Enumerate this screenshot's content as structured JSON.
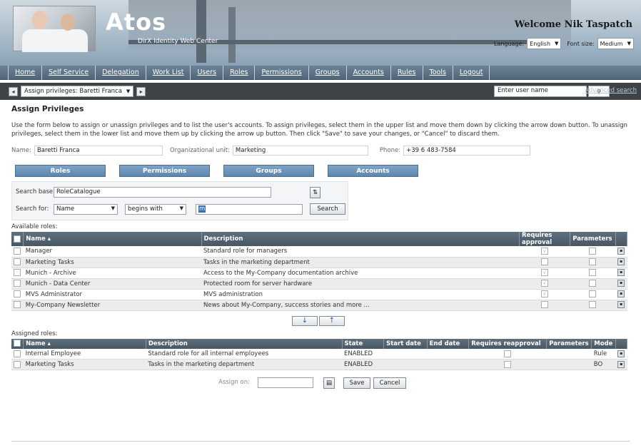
{
  "header": {
    "logo": "Atos",
    "subtitle": "DirX Identity Web Center",
    "welcome": "Welcome Nik Taspatch",
    "language_label": "Language:",
    "language_value": "English",
    "fontsize_label": "Font size:",
    "fontsize_value": "Medium"
  },
  "nav": [
    "Home",
    "Self Service",
    "Delegation",
    "Work List",
    "Users",
    "Roles",
    "Permissions",
    "Groups",
    "Accounts",
    "Rules",
    "Tools",
    "Logout"
  ],
  "toolbar": {
    "crumb": "Assign privileges: Baretti Franca",
    "user_search_placeholder": "Enter user name",
    "advanced_search": "Advanced search"
  },
  "page": {
    "title": "Assign Privileges",
    "instructions": "Use the form below to assign or unassign privileges and to list the user's accounts. To assign privileges, select them in the upper list and move them down by clicking the arrow down button. To unassign privileges, select them in the lower list and move them up by clicking the arrow up button. Then click \"Save\" to save your changes, or \"Cancel\" to discard them.",
    "name_label": "Name:",
    "name_value": "Baretti Franca",
    "ou_label": "Organizational unit:",
    "ou_value": "Marketing",
    "phone_label": "Phone:",
    "phone_value": "+39 6 483-7584"
  },
  "tabs": [
    "Roles",
    "Permissions",
    "Groups",
    "Accounts"
  ],
  "search": {
    "base_label": "Search base:",
    "base_value": "RoleCatalogue",
    "for_label": "Search for:",
    "attr_value": "Name",
    "op_value": "begins with",
    "text_value": "m",
    "button": "Search"
  },
  "available": {
    "label": "Available roles:",
    "columns": [
      "Name",
      "Description",
      "Requires approval",
      "Parameters"
    ],
    "rows": [
      {
        "name": "Manager",
        "desc": "Standard role for managers",
        "approval": "√",
        "params": ""
      },
      {
        "name": "Marketing Tasks",
        "desc": "Tasks in the marketing department",
        "approval": "",
        "params": ""
      },
      {
        "name": "Munich - Archive",
        "desc": "Access to the My-Company documentation archive",
        "approval": "√",
        "params": ""
      },
      {
        "name": "Munich - Data Center",
        "desc": "Protected room for server hardware",
        "approval": "√",
        "params": ""
      },
      {
        "name": "MVS Administrator",
        "desc": "MVS administration",
        "approval": "√",
        "params": ""
      },
      {
        "name": "My-Company Newsletter",
        "desc": "News about My-Company, success stories and more ...",
        "approval": "",
        "params": ""
      }
    ]
  },
  "arrows": {
    "down": "↓",
    "up": "↑"
  },
  "assigned": {
    "label": "Assigned roles:",
    "columns": [
      "Name",
      "Description",
      "State",
      "Start date",
      "End date",
      "Requires reapproval",
      "Parameters",
      "Mode"
    ],
    "rows": [
      {
        "name": "Internal Employee",
        "desc": "Standard role for all internal employees",
        "state": "ENABLED",
        "mode": "Rule"
      },
      {
        "name": "Marketing Tasks",
        "desc": "Tasks in the marketing department",
        "state": "ENABLED",
        "mode": "BO"
      }
    ]
  },
  "actions": {
    "assign_on_label": "Assign on:",
    "save": "Save",
    "cancel": "Cancel"
  }
}
